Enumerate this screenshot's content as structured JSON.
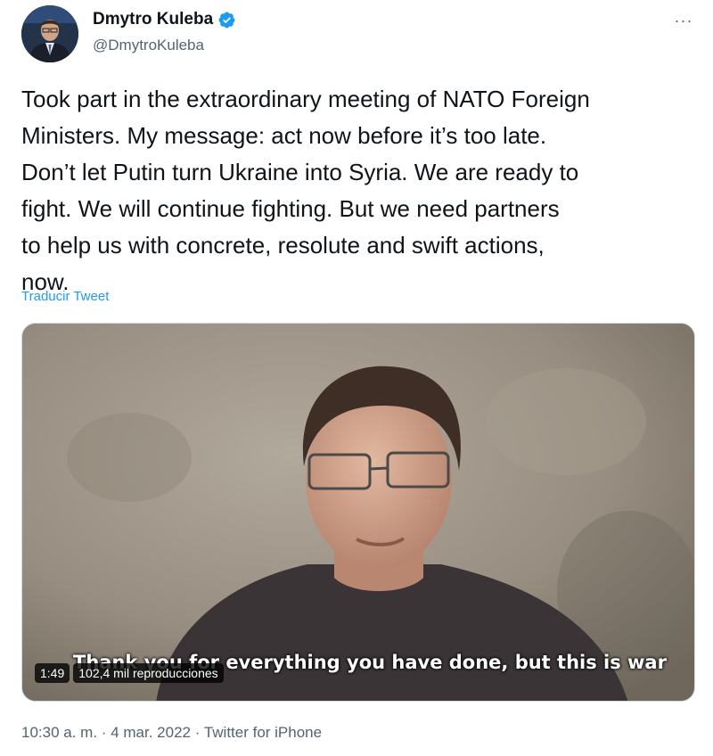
{
  "author": {
    "display_name": "Dmytro Kuleba",
    "handle": "@DmytroKuleba",
    "verified_icon": "verified-badge-icon",
    "avatar_icon": "avatar"
  },
  "more_label": "···",
  "tweet": {
    "text": "Took part in the extraordinary meeting of NATO Foreign\nMinisters. My message: act now before it’s too late.\nDon’t let Putin turn Ukraine into Syria. We are ready to\nfight. We will continue fighting. But we need partners\nto help us with concrete, resolute and swift actions,\nnow.",
    "translate_label": "Traducir Tweet"
  },
  "video": {
    "subtitle": "Thank you for everything you have done, but this is war",
    "duration": "1:49",
    "views": "102,4 mil reproducciones"
  },
  "footer": {
    "time": "10:30 a. m.",
    "separator": "·",
    "date": "4 mar. 2022",
    "source": "Twitter for iPhone"
  },
  "colors": {
    "link": "#1d9bf0",
    "secondary_text": "#536471",
    "primary_text": "#0f1419",
    "verified": "#1d9bf0"
  }
}
